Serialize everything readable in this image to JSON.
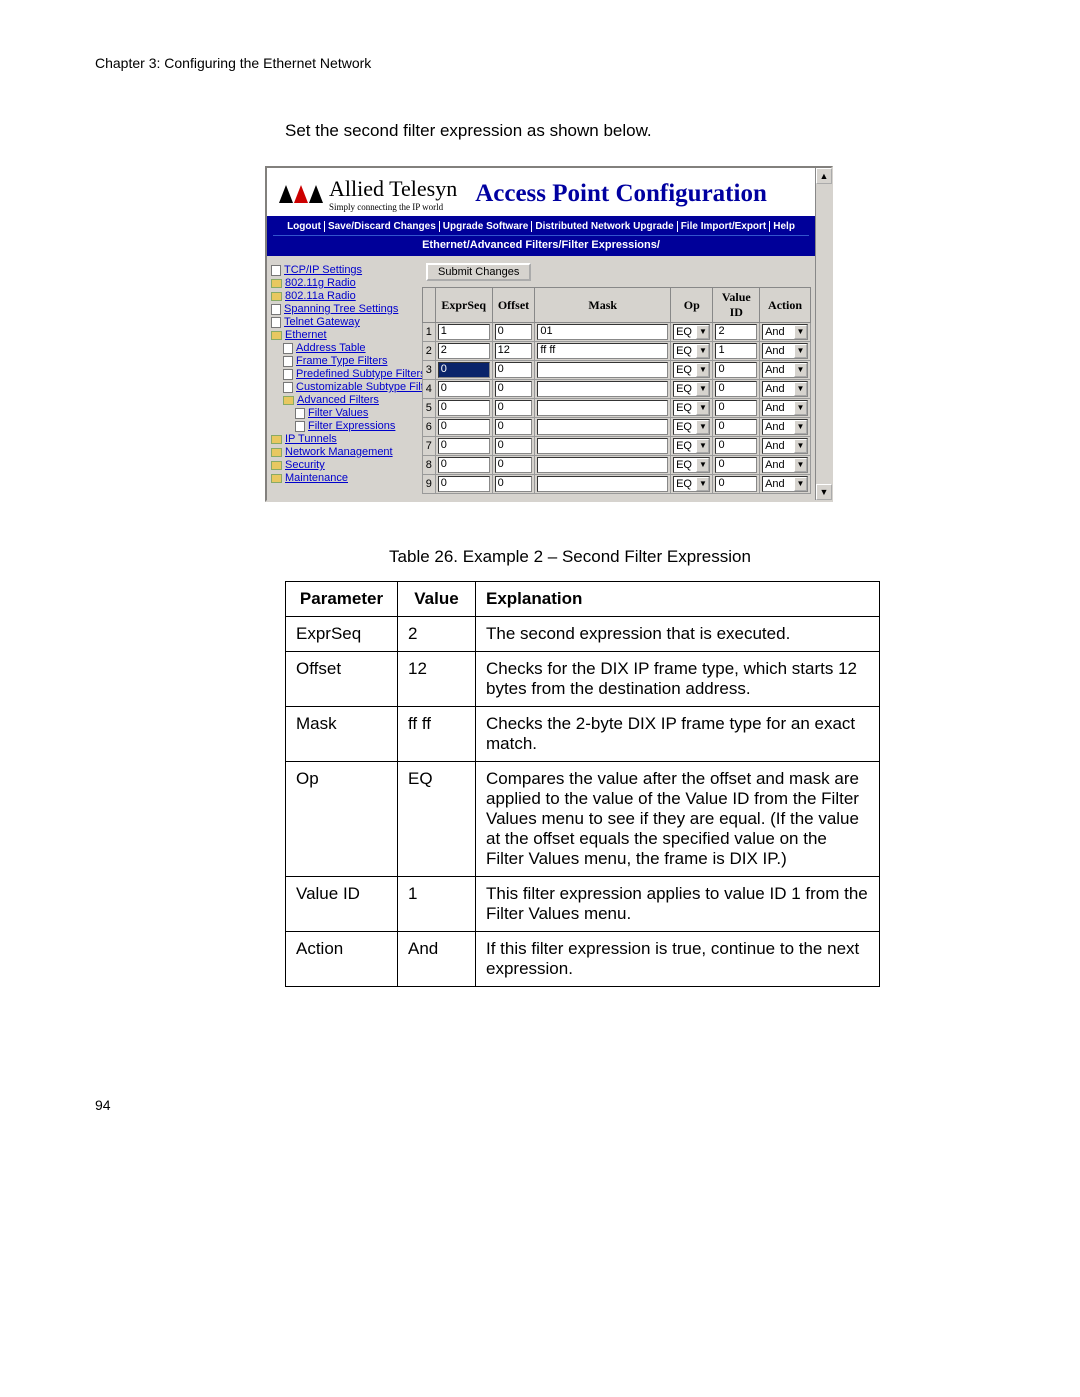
{
  "chapter_header": "Chapter 3: Configuring the Ethernet Network",
  "intro_text": "Set the second filter expression as shown below.",
  "screenshot": {
    "logo_main": "Allied Telesyn",
    "logo_sub": "Simply connecting the IP world",
    "title": "Access Point Configuration",
    "top_menu": [
      "Logout",
      "Save/Discard Changes",
      "Upgrade Software",
      "Distributed Network Upgrade",
      "File Import/Export",
      "Help"
    ],
    "breadcrumb": "Ethernet/Advanced Filters/Filter Expressions/",
    "nav": [
      {
        "l": 0,
        "t": "page",
        "label": "TCP/IP Settings"
      },
      {
        "l": 0,
        "t": "folder",
        "label": "802.11g Radio"
      },
      {
        "l": 0,
        "t": "folder",
        "label": "802.11a Radio"
      },
      {
        "l": 0,
        "t": "page",
        "label": "Spanning Tree Settings"
      },
      {
        "l": 0,
        "t": "page",
        "label": "Telnet Gateway"
      },
      {
        "l": 0,
        "t": "folder",
        "label": "Ethernet"
      },
      {
        "l": 1,
        "t": "page",
        "label": "Address Table"
      },
      {
        "l": 1,
        "t": "page",
        "label": "Frame Type Filters"
      },
      {
        "l": 1,
        "t": "page",
        "label": "Predefined Subtype Filters"
      },
      {
        "l": 1,
        "t": "page",
        "label": "Customizable Subtype Filters"
      },
      {
        "l": 1,
        "t": "folder",
        "label": "Advanced Filters"
      },
      {
        "l": 2,
        "t": "page",
        "label": "Filter Values"
      },
      {
        "l": 2,
        "t": "page",
        "label": "Filter Expressions"
      },
      {
        "l": 0,
        "t": "folder",
        "label": "IP Tunnels"
      },
      {
        "l": 0,
        "t": "folder",
        "label": "Network Management"
      },
      {
        "l": 0,
        "t": "folder",
        "label": "Security"
      },
      {
        "l": 0,
        "t": "folder",
        "label": "Maintenance"
      }
    ],
    "submit_label": "Submit Changes",
    "columns": [
      "ExprSeq",
      "Offset",
      "Mask",
      "Op",
      "Value ID",
      "Action"
    ],
    "rows": [
      {
        "n": "1",
        "seq": "1",
        "off": "0",
        "mask": "01",
        "op": "EQ",
        "vid": "2",
        "act": "And"
      },
      {
        "n": "2",
        "seq": "2",
        "off": "12",
        "mask": "ff ff",
        "op": "EQ",
        "vid": "1",
        "act": "And"
      },
      {
        "n": "3",
        "seq": "0",
        "off": "0",
        "mask": "",
        "op": "EQ",
        "vid": "0",
        "act": "And",
        "sel": true
      },
      {
        "n": "4",
        "seq": "0",
        "off": "0",
        "mask": "",
        "op": "EQ",
        "vid": "0",
        "act": "And"
      },
      {
        "n": "5",
        "seq": "0",
        "off": "0",
        "mask": "",
        "op": "EQ",
        "vid": "0",
        "act": "And"
      },
      {
        "n": "6",
        "seq": "0",
        "off": "0",
        "mask": "",
        "op": "EQ",
        "vid": "0",
        "act": "And"
      },
      {
        "n": "7",
        "seq": "0",
        "off": "0",
        "mask": "",
        "op": "EQ",
        "vid": "0",
        "act": "And"
      },
      {
        "n": "8",
        "seq": "0",
        "off": "0",
        "mask": "",
        "op": "EQ",
        "vid": "0",
        "act": "And"
      },
      {
        "n": "9",
        "seq": "0",
        "off": "0",
        "mask": "",
        "op": "EQ",
        "vid": "0",
        "act": "And"
      }
    ]
  },
  "table_caption": "Table 26. Example 2 – Second Filter Expression",
  "param_headers": [
    "Parameter",
    "Value",
    "Explanation"
  ],
  "param_rows": [
    {
      "p": "ExprSeq",
      "v": "2",
      "e": "The second expression that is executed."
    },
    {
      "p": "Offset",
      "v": "12",
      "e": "Checks for the DIX IP frame type, which starts 12 bytes from the destination address."
    },
    {
      "p": "Mask",
      "v": "ff ff",
      "e": "Checks the 2-byte DIX IP frame type for an exact match."
    },
    {
      "p": "Op",
      "v": "EQ",
      "e": "Compares the value after the offset and mask are applied to the value of the Value ID from the Filter Values menu to see if they are equal. (If the value at the offset equals the specified value on the Filter Values menu, the frame is DIX IP.)"
    },
    {
      "p": "Value ID",
      "v": "1",
      "e": "This filter expression applies to value ID 1 from the Filter Values menu."
    },
    {
      "p": "Action",
      "v": "And",
      "e": "If this filter expression is true, continue to the next expression."
    }
  ],
  "page_number": "94",
  "glyph_down": "▼",
  "glyph_up": "▲"
}
